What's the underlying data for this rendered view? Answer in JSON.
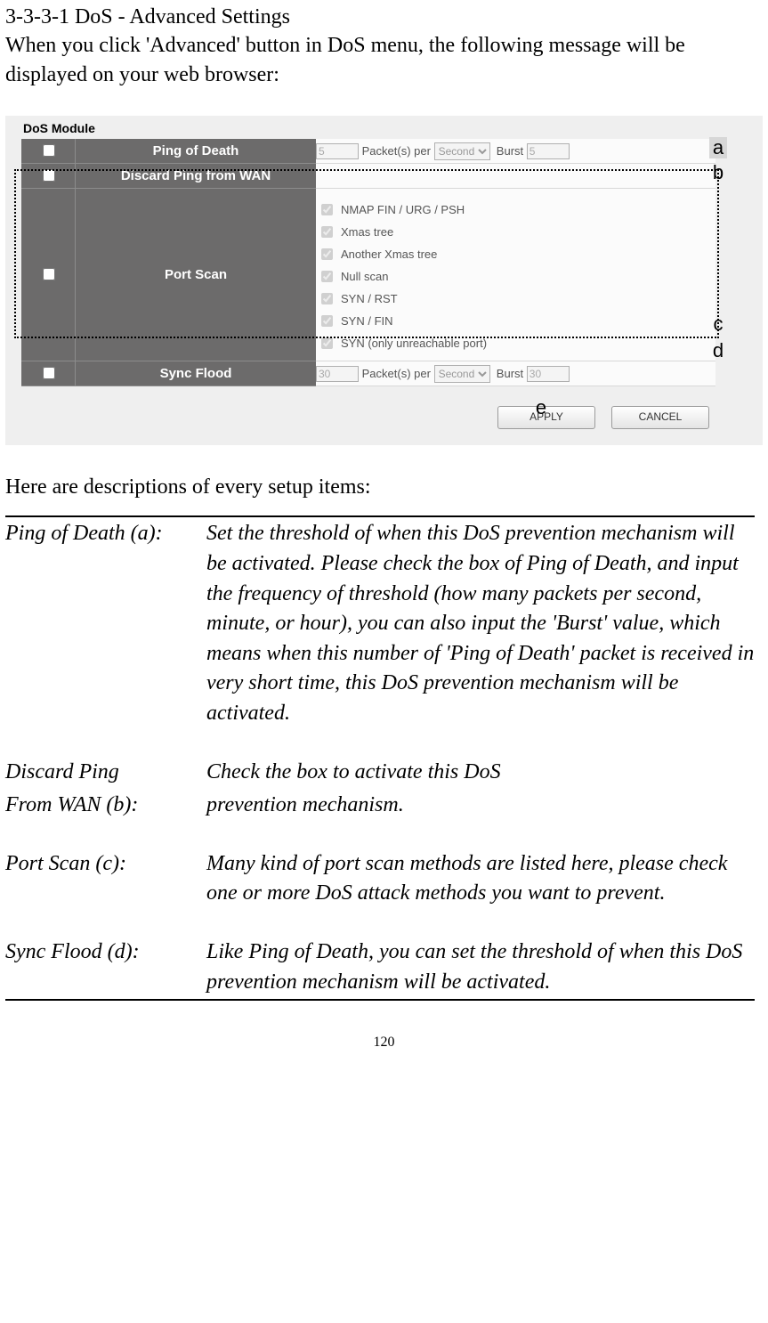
{
  "heading": "3-3-3-1 DoS - Advanced Settings",
  "intro": "When you click 'Advanced' button in DoS menu, the following message will be displayed on your web browser:",
  "module": {
    "title": "DoS Module",
    "rows": {
      "ping_of_death": {
        "label": "Ping of Death",
        "packets": "5",
        "packets_per": "Packet(s) per",
        "unit": "Second",
        "burst_label": "Burst",
        "burst": "5"
      },
      "discard_ping": {
        "label": "Discard Ping from WAN"
      },
      "port_scan": {
        "label": "Port Scan",
        "items": [
          "NMAP FIN / URG / PSH",
          "Xmas tree",
          "Another Xmas tree",
          "Null scan",
          "SYN / RST",
          "SYN / FIN",
          "SYN (only unreachable port)"
        ]
      },
      "sync_flood": {
        "label": "Sync Flood",
        "packets": "30",
        "packets_per": "Packet(s) per",
        "unit": "Second",
        "burst_label": "Burst",
        "burst": "30"
      }
    },
    "buttons": {
      "apply": "APPLY",
      "cancel": "CANCEL"
    },
    "annotations": {
      "a": "a",
      "b": "b",
      "c": "c",
      "d": "d",
      "e": "e"
    }
  },
  "descs_intro": "Here are descriptions of every setup items:",
  "descriptions": [
    {
      "term": "Ping of Death (a):",
      "text": "Set the threshold of when this DoS prevention mechanism will be activated. Please check the box of Ping of Death, and input the frequency of threshold (how many packets per second, minute, or hour), you can also input the 'Burst' value, which means when this number of 'Ping of Death' packet is received in very short time, this DoS prevention mechanism will be activated."
    },
    {
      "term": "Discard Ping",
      "term2": "From WAN (b):",
      "text": "Check the box to activate this DoS",
      "text2": "prevention mechanism."
    },
    {
      "term": "Port Scan (c):",
      "text": "Many kind of port scan methods are listed here, please check one or more DoS attack methods you want to prevent."
    },
    {
      "term": "Sync Flood (d):",
      "text": "Like Ping of Death, you can set the threshold of when this DoS prevention mechanism will be activated."
    }
  ],
  "page_number": "120"
}
